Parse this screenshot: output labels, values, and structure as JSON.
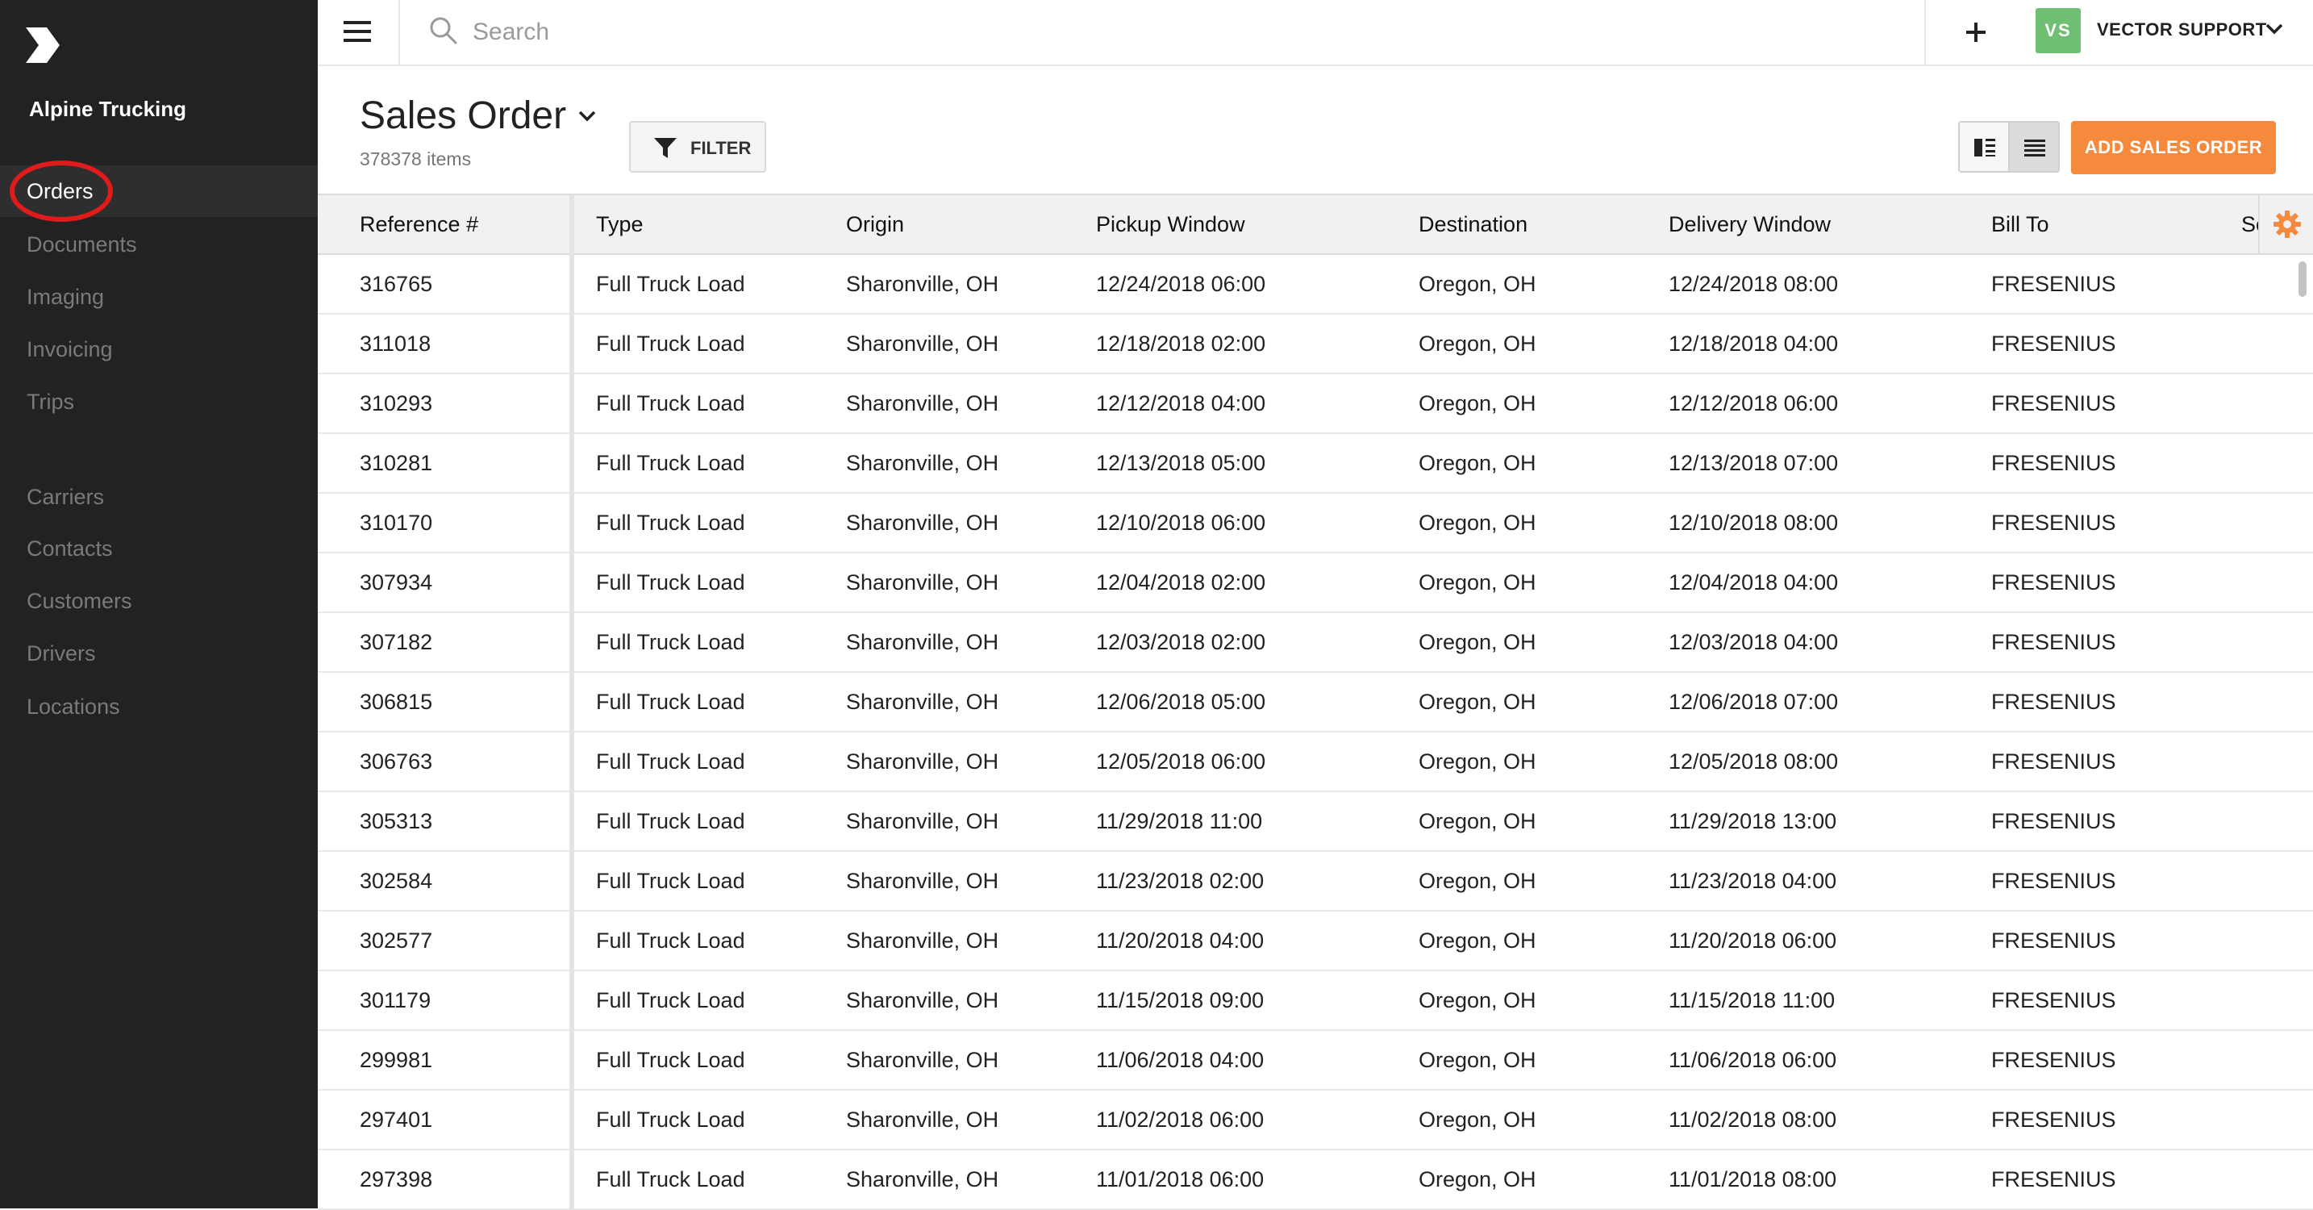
{
  "sidebar": {
    "company_name": "Alpine Trucking",
    "items": [
      {
        "label": "Orders",
        "active": true
      },
      {
        "label": "Documents"
      },
      {
        "label": "Imaging"
      },
      {
        "label": "Invoicing"
      },
      {
        "label": "Trips"
      },
      {
        "label": "Carriers"
      },
      {
        "label": "Contacts"
      },
      {
        "label": "Customers"
      },
      {
        "label": "Drivers"
      },
      {
        "label": "Locations"
      }
    ]
  },
  "header": {
    "search_placeholder": "Search",
    "user_initials": "VS",
    "user_name": "VECTOR SUPPORT"
  },
  "page": {
    "title": "Sales Order",
    "item_count": "378378 items",
    "filter_label": "FILTER",
    "add_button_label": "ADD SALES ORDER"
  },
  "table": {
    "columns": [
      "Reference #",
      "Type",
      "Origin",
      "Pickup Window",
      "Destination",
      "Delivery Window",
      "Bill To",
      "Se"
    ],
    "rows": [
      [
        "316765",
        "Full Truck Load",
        "Sharonville, OH",
        "12/24/2018 06:00",
        "Oregon, OH",
        "12/24/2018 08:00",
        "FRESENIUS"
      ],
      [
        "311018",
        "Full Truck Load",
        "Sharonville, OH",
        "12/18/2018 02:00",
        "Oregon, OH",
        "12/18/2018 04:00",
        "FRESENIUS"
      ],
      [
        "310293",
        "Full Truck Load",
        "Sharonville, OH",
        "12/12/2018 04:00",
        "Oregon, OH",
        "12/12/2018 06:00",
        "FRESENIUS"
      ],
      [
        "310281",
        "Full Truck Load",
        "Sharonville, OH",
        "12/13/2018 05:00",
        "Oregon, OH",
        "12/13/2018 07:00",
        "FRESENIUS"
      ],
      [
        "310170",
        "Full Truck Load",
        "Sharonville, OH",
        "12/10/2018 06:00",
        "Oregon, OH",
        "12/10/2018 08:00",
        "FRESENIUS"
      ],
      [
        "307934",
        "Full Truck Load",
        "Sharonville, OH",
        "12/04/2018 02:00",
        "Oregon, OH",
        "12/04/2018 04:00",
        "FRESENIUS"
      ],
      [
        "307182",
        "Full Truck Load",
        "Sharonville, OH",
        "12/03/2018 02:00",
        "Oregon, OH",
        "12/03/2018 04:00",
        "FRESENIUS"
      ],
      [
        "306815",
        "Full Truck Load",
        "Sharonville, OH",
        "12/06/2018 05:00",
        "Oregon, OH",
        "12/06/2018 07:00",
        "FRESENIUS"
      ],
      [
        "306763",
        "Full Truck Load",
        "Sharonville, OH",
        "12/05/2018 06:00",
        "Oregon, OH",
        "12/05/2018 08:00",
        "FRESENIUS"
      ],
      [
        "305313",
        "Full Truck Load",
        "Sharonville, OH",
        "11/29/2018 11:00",
        "Oregon, OH",
        "11/29/2018 13:00",
        "FRESENIUS"
      ],
      [
        "302584",
        "Full Truck Load",
        "Sharonville, OH",
        "11/23/2018 02:00",
        "Oregon, OH",
        "11/23/2018 04:00",
        "FRESENIUS"
      ],
      [
        "302577",
        "Full Truck Load",
        "Sharonville, OH",
        "11/20/2018 04:00",
        "Oregon, OH",
        "11/20/2018 06:00",
        "FRESENIUS"
      ],
      [
        "301179",
        "Full Truck Load",
        "Sharonville, OH",
        "11/15/2018 09:00",
        "Oregon, OH",
        "11/15/2018 11:00",
        "FRESENIUS"
      ],
      [
        "299981",
        "Full Truck Load",
        "Sharonville, OH",
        "11/06/2018 04:00",
        "Oregon, OH",
        "11/06/2018 06:00",
        "FRESENIUS"
      ],
      [
        "297401",
        "Full Truck Load",
        "Sharonville, OH",
        "11/02/2018 06:00",
        "Oregon, OH",
        "11/02/2018 08:00",
        "FRESENIUS"
      ],
      [
        "297398",
        "Full Truck Load",
        "Sharonville, OH",
        "11/01/2018 06:00",
        "Oregon, OH",
        "11/01/2018 08:00",
        "FRESENIUS"
      ]
    ]
  },
  "colors": {
    "sidebar_bg": "#222222",
    "accent_orange": "#f58a3d",
    "avatar_green": "#6fbf73",
    "highlight_ring": "#e01b1b"
  },
  "icons": [
    "logo-icon",
    "hamburger-icon",
    "search-icon",
    "plus-icon",
    "chevron-down-icon",
    "filter-icon",
    "split-view-icon",
    "list-view-icon",
    "gear-icon"
  ]
}
